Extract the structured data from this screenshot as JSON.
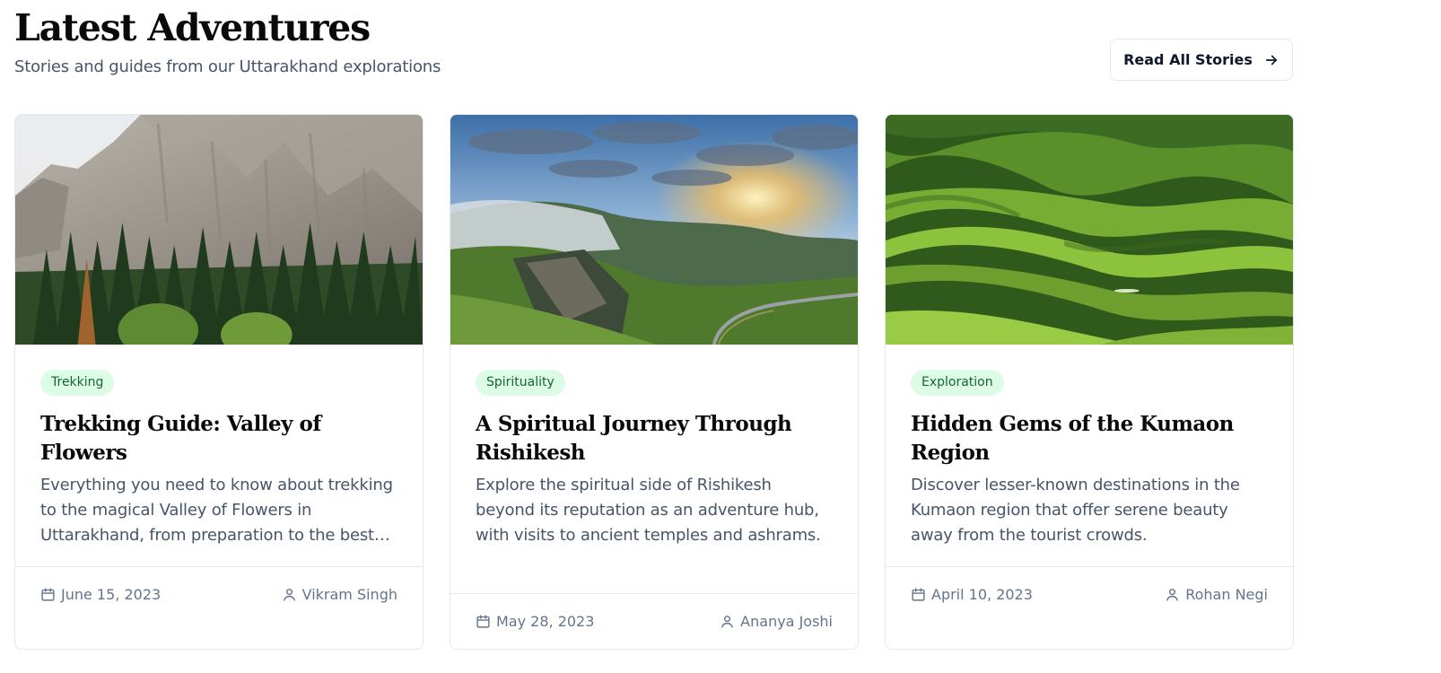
{
  "header": {
    "title": "Latest Adventures",
    "subtitle": "Stories and guides from our Uttarakhand explorations",
    "read_all_label": "Read All Stories"
  },
  "icons": {
    "arrow": "arrow-right-icon",
    "date": "calendar-icon",
    "author": "user-icon"
  },
  "colors": {
    "tag_bg": "#dcfce7",
    "tag_text": "#166534",
    "border": "#e5e7eb"
  },
  "cards": [
    {
      "tag": "Trekking",
      "title": "Trekking Guide: Valley of Flowers",
      "excerpt": "Everything you need to know about trekking to the magical Valley of Flowers in Uttarakhand, from preparation to the best time to visit.",
      "date": "June 15, 2023",
      "author": "Vikram Singh"
    },
    {
      "tag": "Spirituality",
      "title": "A Spiritual Journey Through Rishikesh",
      "excerpt": "Explore the spiritual side of Rishikesh beyond its reputation as an adventure hub, with visits to ancient temples and ashrams.",
      "date": "May 28, 2023",
      "author": "Ananya Joshi"
    },
    {
      "tag": "Exploration",
      "title": "Hidden Gems of the Kumaon Region",
      "excerpt": "Discover lesser-known destinations in the Kumaon region that offer serene beauty away from the tourist crowds.",
      "date": "April 10, 2023",
      "author": "Rohan Negi"
    }
  ]
}
